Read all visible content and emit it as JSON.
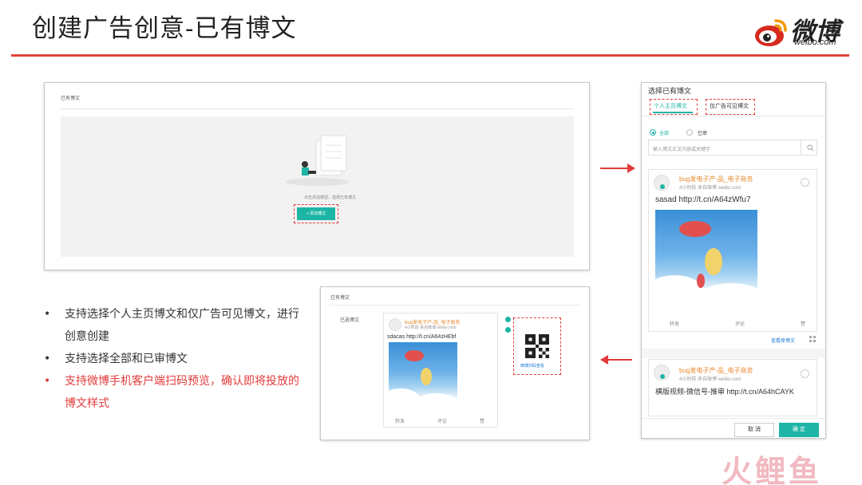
{
  "slide": {
    "title": "创建广告创意-已有博文",
    "logo": {
      "cn": "微博",
      "en": "weibo.com"
    },
    "watermark": "火鲤鱼",
    "bullets": [
      {
        "text": "支持选择个人主页博文和仅广告可见博文，进行创意创建",
        "highlight": false
      },
      {
        "text": "支持选择全部和已审博文",
        "highlight": false
      },
      {
        "text": "支持微博手机客户端扫码预览，确认即将投放的博文样式",
        "highlight": true
      }
    ],
    "accent_color": "#e23b3b",
    "brand_color": "#1fb5a6"
  },
  "empty_panel": {
    "header": "已有博文",
    "hint": "点击添加按钮，选择已有博文",
    "add_button": "+ 添加博文"
  },
  "preview_panel": {
    "header": "已有博文",
    "field_label": "已选博文",
    "post": {
      "author": "bug发电子产-品_电子商务",
      "meta": "4小时前 来自微博 weibo.com",
      "text": "sdacas http://t.cn/A64zHEbf",
      "actions": [
        "转发",
        "评论",
        "赞"
      ]
    },
    "qr_label": "微博扫码查看"
  },
  "picker": {
    "title": "选择已有博文",
    "tabs": [
      "个人主页博文",
      "仅广告可见博文"
    ],
    "filters": [
      "全部",
      "已审"
    ],
    "selected_filter": "全部",
    "search_placeholder": "输入博文正文内容或关键字",
    "posts": [
      {
        "author": "bug发电子产-品_电子商务",
        "meta": "4小时前 来自微博 weibo.com",
        "text": "sasad http://t.cn/A64zWfu7",
        "actions": [
          "转发",
          "评论",
          "赞"
        ],
        "link": "查看原博文"
      },
      {
        "author": "bug发电子产-品_电子商务",
        "meta": "4小时前 来自微博 weibo.com",
        "text": "横版视频-微信号-推审 http://t.cn/A64hCAYK"
      }
    ],
    "cancel": "取 消",
    "confirm": "确 定"
  }
}
